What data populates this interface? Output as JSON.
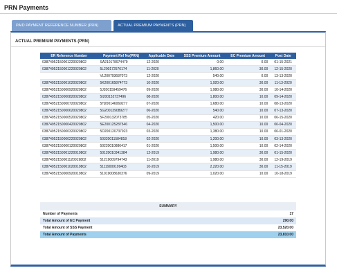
{
  "page": {
    "title": "PRN Payments"
  },
  "tabs": [
    {
      "label": "PAID PAYMENT REFERENCE NUMBER (PRN)"
    },
    {
      "label": "ACTUAL PREMIUM PAYMENTS (PRN)"
    }
  ],
  "section": {
    "title": "ACTUAL PREMIUM PAYMENTS (PRN)"
  },
  "table": {
    "headers": [
      "ER Reference Number",
      "Payment Ref No(PRN)",
      "Applicable Date",
      "SSS Premium Amount",
      "EC Premium Amount",
      "Post Date"
    ],
    "rows": [
      [
        "03874952150001220020802",
        "SA210178974479",
        "12-2020",
        "0.00",
        "0.00",
        "01-15-2021"
      ],
      [
        "03874952150001220020802",
        "5L200172576174",
        "11-2020",
        "1,860.00",
        "30.00",
        "12-15-2020"
      ],
      [
        "",
        "VL200793687073",
        "12-2020",
        "540.00",
        "0.00",
        "13-13-2020"
      ],
      [
        "03874952150001020020802",
        "5K200165874773",
        "10-2020",
        "1,920.00",
        "30.00",
        "11-13-2020"
      ],
      [
        "03874952150000920020802",
        "5J200159459476",
        "09-2020",
        "1,980.00",
        "30.00",
        "10-14-2020"
      ],
      [
        "03874952150000820020802",
        "5I200152737496",
        "08-2020",
        "1,800.00",
        "10.00",
        "09-14-2020"
      ],
      [
        "03874952150000720020802",
        "5H200146069277",
        "07-2020",
        "1,680.00",
        "10.00",
        "08-13-2020"
      ],
      [
        "03874952150000620020802",
        "5G200139089277",
        "06-2020",
        "540.00",
        "10.00",
        "07-13-2020"
      ],
      [
        "03874952150000520020802",
        "5F200132073785",
        "05-2020",
        "420.00",
        "10.00",
        "06-15-2020"
      ],
      [
        "03874952150000420020802",
        "5E200125287546",
        "04-2020",
        "1,500.00",
        "10.00",
        "06-04-2020"
      ],
      [
        "03874952150000320020802",
        "5D200120737923",
        "03-2020",
        "1,380.00",
        "10.00",
        "06-01-2020"
      ],
      [
        "03874952150000220020802",
        "50320011584818",
        "02-2020",
        "1,200.00",
        "10.00",
        "03-13-2020"
      ],
      [
        "03874952150000120020802",
        "50220010886417",
        "01-2020",
        "1,500.00",
        "10.00",
        "02-14-2020"
      ],
      [
        "03874952150001220019802",
        "50120010341384",
        "12-2019",
        "1,980.00",
        "30.00",
        "01-15-2020"
      ],
      [
        "03874952150001120019802",
        "51219009794743",
        "11-2019",
        "1,980.00",
        "30.00",
        "12-19-2019"
      ],
      [
        "03874952150001020019802",
        "51119009199403",
        "10-2019",
        "2,220.00",
        "30.00",
        "11-15-2019"
      ],
      [
        "03874952150000920019802",
        "51019008630376",
        "09-2019",
        "1,020.00",
        "10.00",
        "10-18-2019"
      ]
    ]
  },
  "summary": {
    "title": "SUMMARY",
    "rows": [
      {
        "label": "Number of Payments",
        "value": "17"
      },
      {
        "label": "Total Amount of EC Payment",
        "value": "290.00"
      },
      {
        "label": "Total Amount of SSS Payment",
        "value": "23,520.00"
      },
      {
        "label": "Total Amount of Payments",
        "value": "23,810.00"
      }
    ]
  },
  "colors": {
    "accent": "#2e5f9f",
    "tab_inactive": "#7ea0cf",
    "row_alt": "#e6eef8",
    "total_highlight": "#9fd1ee"
  }
}
